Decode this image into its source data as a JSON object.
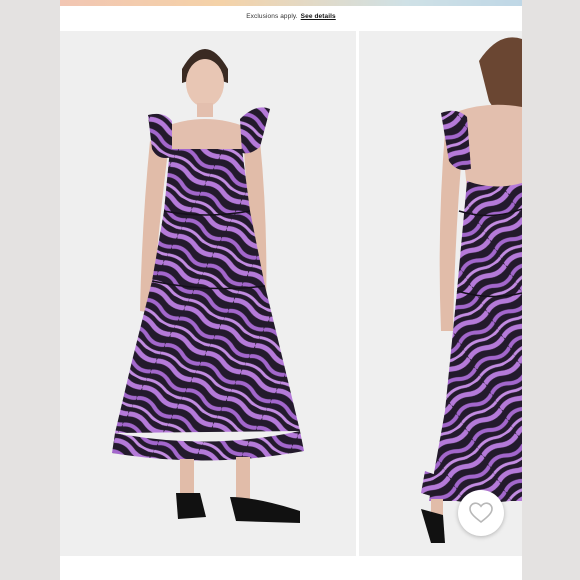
{
  "promo": {
    "text": "Exclusions apply.",
    "link_label": "See details"
  },
  "gallery": {
    "images": [
      {
        "name": "front-view",
        "alt": "Model wearing purple zebra print tiered maxi dress, front view"
      },
      {
        "name": "back-view",
        "alt": "Model wearing purple zebra print tiered maxi dress, back view"
      }
    ]
  },
  "favorite": {
    "icon": "heart-outline-icon"
  },
  "colors": {
    "dress_dark": "#231a2c",
    "dress_light": "#b57ad9",
    "photo_bg": "#efefef",
    "accent_bar_start": "#f2c6b3",
    "accent_bar_end": "#bfd7e6"
  }
}
